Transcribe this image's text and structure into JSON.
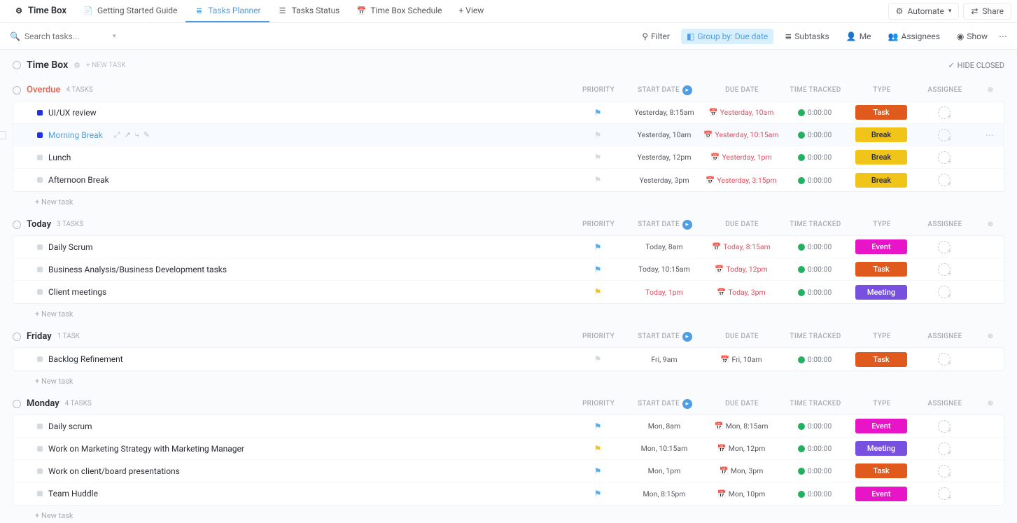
{
  "top": {
    "title": "Time Box",
    "tabs": [
      {
        "label": "Getting Started Guide",
        "icon": "doc"
      },
      {
        "label": "Tasks Planner",
        "icon": "list",
        "active": true
      },
      {
        "label": "Tasks Status",
        "icon": "status"
      },
      {
        "label": "Time Box Schedule",
        "icon": "calendar"
      }
    ],
    "add_view": "+ View",
    "automate": "Automate",
    "share": "Share"
  },
  "toolbar": {
    "search_placeholder": "Search tasks...",
    "filter": "Filter",
    "group_by": "Group by: Due date",
    "subtasks": "Subtasks",
    "me": "Me",
    "assignees": "Assignees",
    "show": "Show"
  },
  "crumb": {
    "title": "Time Box",
    "new_task": "+ NEW TASK",
    "hide_closed": "HIDE CLOSED"
  },
  "columns": [
    "PRIORITY",
    "START DATE",
    "DUE DATE",
    "TIME TRACKED",
    "TYPE",
    "ASSIGNEE"
  ],
  "groups": [
    {
      "title": "Overdue",
      "style": "overdue",
      "count": "4 TASKS",
      "tasks": [
        {
          "name": "UI/UX review",
          "status": "#1f34e0",
          "flagColor": "#4fb0f2",
          "start": "Yesterday, 8:15am",
          "due": "Yesterday, 10am",
          "dueRed": true,
          "time": "0:00:00",
          "type": "Task",
          "typeClass": "type-task"
        },
        {
          "name": "Morning Break",
          "status": "#1f34e0",
          "flagColor": "#d5d9e0",
          "start": "Yesterday, 10am",
          "due": "Yesterday, 10:15am",
          "dueRed": true,
          "time": "0:00:00",
          "type": "Break",
          "typeClass": "type-break",
          "hover": true
        },
        {
          "name": "Lunch",
          "status": "#d5d9e0",
          "flagColor": "#d5d9e0",
          "start": "Yesterday, 12pm",
          "due": "Yesterday, 1pm",
          "dueRed": true,
          "time": "0:00:00",
          "type": "Break",
          "typeClass": "type-break"
        },
        {
          "name": "Afternoon Break",
          "status": "#d5d9e0",
          "flagColor": "#d5d9e0",
          "start": "Yesterday, 3pm",
          "due": "Yesterday, 3:15pm",
          "dueRed": true,
          "time": "0:00:00",
          "type": "Break",
          "typeClass": "type-break"
        }
      ]
    },
    {
      "title": "Today",
      "style": "normal",
      "count": "3 TASKS",
      "tasks": [
        {
          "name": "Daily Scrum",
          "status": "#d5d9e0",
          "flagColor": "#4fb0f2",
          "start": "Today, 8am",
          "due": "Today, 8:15am",
          "dueRed": true,
          "time": "0:00:00",
          "type": "Event",
          "typeClass": "type-event"
        },
        {
          "name": "Business Analysis/Business Development tasks",
          "status": "#d5d9e0",
          "flagColor": "#4fb0f2",
          "start": "Today, 10:15am",
          "due": "Today, 12pm",
          "dueRed": true,
          "time": "0:00:00",
          "type": "Task",
          "typeClass": "type-task"
        },
        {
          "name": "Client meetings",
          "status": "#d5d9e0",
          "flagColor": "#f0c419",
          "start": "Today, 1pm",
          "startRed": true,
          "due": "Today, 3pm",
          "dueRed": true,
          "time": "0:00:00",
          "type": "Meeting",
          "typeClass": "type-meeting"
        }
      ]
    },
    {
      "title": "Friday",
      "style": "normal",
      "count": "1 TASK",
      "tasks": [
        {
          "name": "Backlog Refinement",
          "status": "#d5d9e0",
          "flagColor": "#d5d9e0",
          "start": "Fri, 9am",
          "due": "Fri, 10am",
          "time": "0:00:00",
          "type": "Task",
          "typeClass": "type-task"
        }
      ]
    },
    {
      "title": "Monday",
      "style": "normal",
      "count": "4 TASKS",
      "tasks": [
        {
          "name": "Daily scrum",
          "status": "#d5d9e0",
          "flagColor": "#4fb0f2",
          "start": "Mon, 8am",
          "due": "Mon, 8:15am",
          "time": "0:00:00",
          "type": "Event",
          "typeClass": "type-event"
        },
        {
          "name": "Work on Marketing Strategy with Marketing Manager",
          "status": "#d5d9e0",
          "flagColor": "#f0c419",
          "start": "Mon, 10:15am",
          "due": "Mon, 12pm",
          "time": "0:00:00",
          "type": "Meeting",
          "typeClass": "type-meeting"
        },
        {
          "name": "Work on client/board presentations",
          "status": "#d5d9e0",
          "flagColor": "#4fb0f2",
          "start": "Mon, 1pm",
          "due": "Mon, 3pm",
          "time": "0:00:00",
          "type": "Task",
          "typeClass": "type-task"
        },
        {
          "name": "Team Huddle",
          "status": "#d5d9e0",
          "flagColor": "#4fb0f2",
          "start": "Mon, 8:15pm",
          "due": "Mon, 10pm",
          "time": "0:00:00",
          "type": "Event",
          "typeClass": "type-event"
        }
      ]
    }
  ],
  "new_task_label": "+ New task"
}
